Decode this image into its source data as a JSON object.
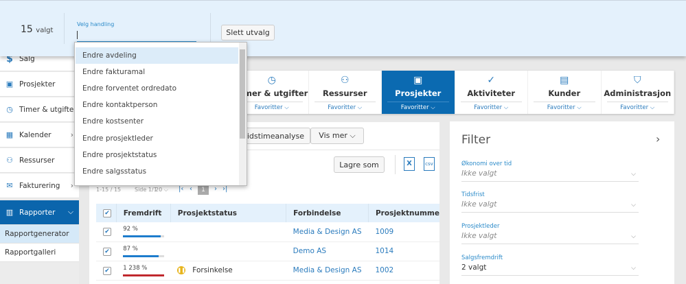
{
  "selection_bar": {
    "count": "15",
    "count_suffix": "valgt",
    "action_label": "Velg handling",
    "action_value": "",
    "clear_button": "Slett utvalg"
  },
  "action_dropdown": {
    "items": [
      "Endre avdeling",
      "Endre fakturamal",
      "Endre forventet ordredato",
      "Endre kontaktperson",
      "Endre kostsenter",
      "Endre prosjektleder",
      "Endre prosjektstatus",
      "Endre salgsstatus"
    ]
  },
  "sidebar": {
    "items": [
      {
        "label": "Salg",
        "icon": "$"
      },
      {
        "label": "Prosjekter",
        "icon": "▣"
      },
      {
        "label": "Timer & utgifter",
        "icon": "◷"
      },
      {
        "label": "Kalender",
        "icon": "▦"
      },
      {
        "label": "Ressurser",
        "icon": "⚇"
      },
      {
        "label": "Fakturering",
        "icon": "✉"
      },
      {
        "label": "Rapporter",
        "icon": "▥"
      }
    ],
    "subitems": [
      "Rapportgenerator",
      "Rapportgalleri"
    ]
  },
  "nav": {
    "tiles": [
      {
        "label": "Timer & utgifter",
        "icon": "◷"
      },
      {
        "label": "Ressurser",
        "icon": "⚇"
      },
      {
        "label": "Prosjekter",
        "icon": "▣"
      },
      {
        "label": "Aktiviteter",
        "icon": "✓"
      },
      {
        "label": "Kunder",
        "icon": "▤"
      },
      {
        "label": "Administrasjon",
        "icon": "⛉"
      }
    ],
    "favorites": "Favoritter ⌵"
  },
  "toolbar": {
    "analysis_button": "beidstimeanalyse",
    "more_button": "Vis mer ⌵",
    "save_as": "Lagre som",
    "excel": "X",
    "csv": "csv"
  },
  "pagination": {
    "range": "1-15 / 15",
    "page": "Side 1/1",
    "per_page": "20 ⌵",
    "current": "1"
  },
  "table": {
    "headers": [
      "Fremdrift",
      "Prosjektstatus",
      "Forbindelse",
      "Prosjektnumme"
    ],
    "rows": [
      {
        "progress": "92 %",
        "progress_value": 92,
        "status": "",
        "customer": "Media & Design AS",
        "number": "1009",
        "color": "#1d7ccc"
      },
      {
        "progress": "87 %",
        "progress_value": 87,
        "status": "",
        "customer": "Demo AS",
        "number": "1014",
        "color": "#1d7ccc"
      },
      {
        "progress": "1 238 %",
        "progress_value": 100,
        "status": "Forsinkelse",
        "customer": "Media & Design AS",
        "number": "1002",
        "color": "#c0282d"
      }
    ]
  },
  "filter": {
    "title": "Filter",
    "fields": [
      {
        "label": "Økonomi over tid",
        "value": "Ikke valgt"
      },
      {
        "label": "Tidsfrist",
        "value": "Ikke valgt"
      },
      {
        "label": "Prosjektleder",
        "value": "Ikke valgt"
      },
      {
        "label": "Salgsfremdrift",
        "value": "2 valgt"
      }
    ]
  }
}
